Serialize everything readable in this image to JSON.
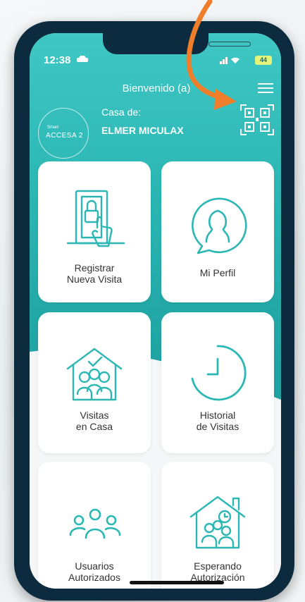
{
  "status": {
    "time": "12:38",
    "battery": "44"
  },
  "header": {
    "title": "Bienvenido (a)"
  },
  "logo": {
    "small": "Smart",
    "main": "ACCESA 2"
  },
  "house": {
    "label": "Casa de:",
    "owner": "ELMER MICULAX"
  },
  "cards": [
    {
      "label": "Registrar\nNueva Visita",
      "icon": "door-hand-icon"
    },
    {
      "label": "Mi Perfil",
      "icon": "profile-icon"
    },
    {
      "label": "Visitas\nen Casa",
      "icon": "house-visitors-icon"
    },
    {
      "label": "Historial\nde Visitas",
      "icon": "clock-icon"
    },
    {
      "label": "Usuarios\nAutorizados",
      "icon": "users-icon"
    },
    {
      "label": "Esperando\nAutorización",
      "icon": "house-waiting-icon"
    }
  ],
  "colors": {
    "teal": "#2ab5b3",
    "icon": "#2bb7b4",
    "arrow": "#ef7d2a",
    "frame": "#0d2b3e"
  }
}
